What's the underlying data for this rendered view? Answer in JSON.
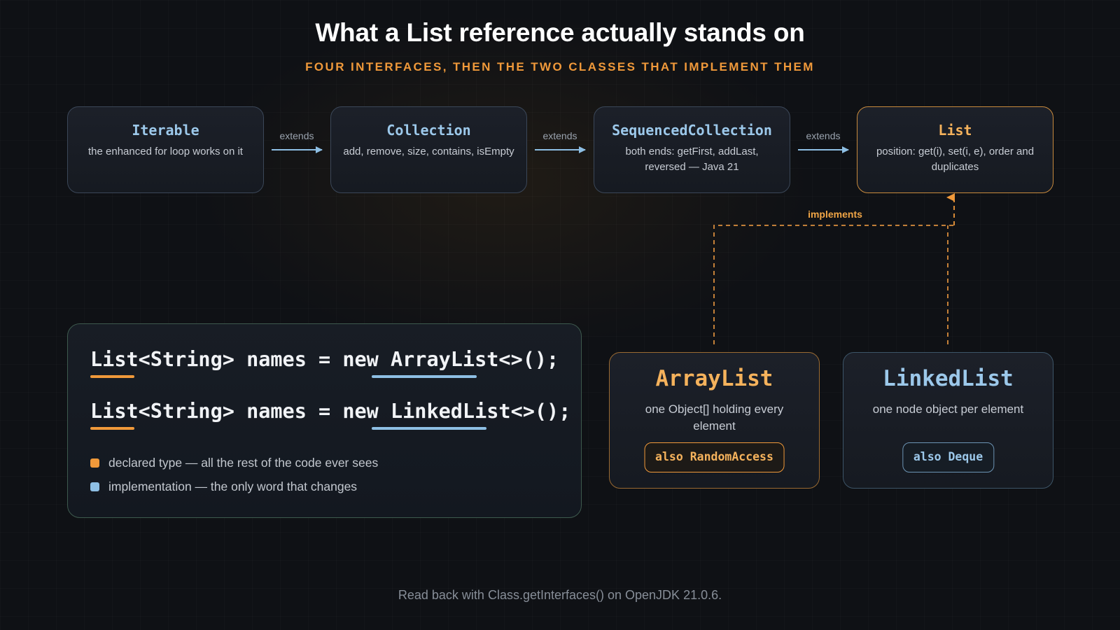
{
  "title": "What a List reference actually stands on",
  "subtitle": "FOUR INTERFACES, THEN THE TWO CLASSES THAT IMPLEMENT THEM",
  "interfaces": [
    {
      "name": "Iterable",
      "description": "the enhanced for loop works on it"
    },
    {
      "name": "Collection",
      "description": "add, remove, size, contains, isEmpty"
    },
    {
      "name": "SequencedCollection",
      "description": "both ends: getFirst, addLast, reversed — Java 21"
    },
    {
      "name": "List",
      "description": "position: get(i), set(i, e), order and duplicates"
    }
  ],
  "edges": {
    "extends_label": "extends",
    "implements_label": "implements"
  },
  "code": {
    "lines": [
      {
        "declared": "List<String>",
        "rest": " names = new ",
        "impl": "ArrayList",
        "tail": "<>();"
      },
      {
        "declared": "List<String>",
        "rest": " names = new ",
        "impl": "LinkedList",
        "tail": "<>();"
      }
    ],
    "legend": [
      {
        "text": "declared type — all the rest of the code ever sees",
        "color": "#f0993a"
      },
      {
        "text": "implementation — the only word that changes",
        "color": "#8ebfe4"
      }
    ]
  },
  "classes": [
    {
      "name": "ArrayList",
      "description": "one Object[] holding every element",
      "badge": "also RandomAccess",
      "accent": "#f0993a"
    },
    {
      "name": "LinkedList",
      "description": "one node object per element",
      "badge": "also Deque",
      "accent": "#8ebfe4"
    }
  ],
  "footer": "Read back with Class.getInterfaces() on OpenJDK 21.0.6."
}
